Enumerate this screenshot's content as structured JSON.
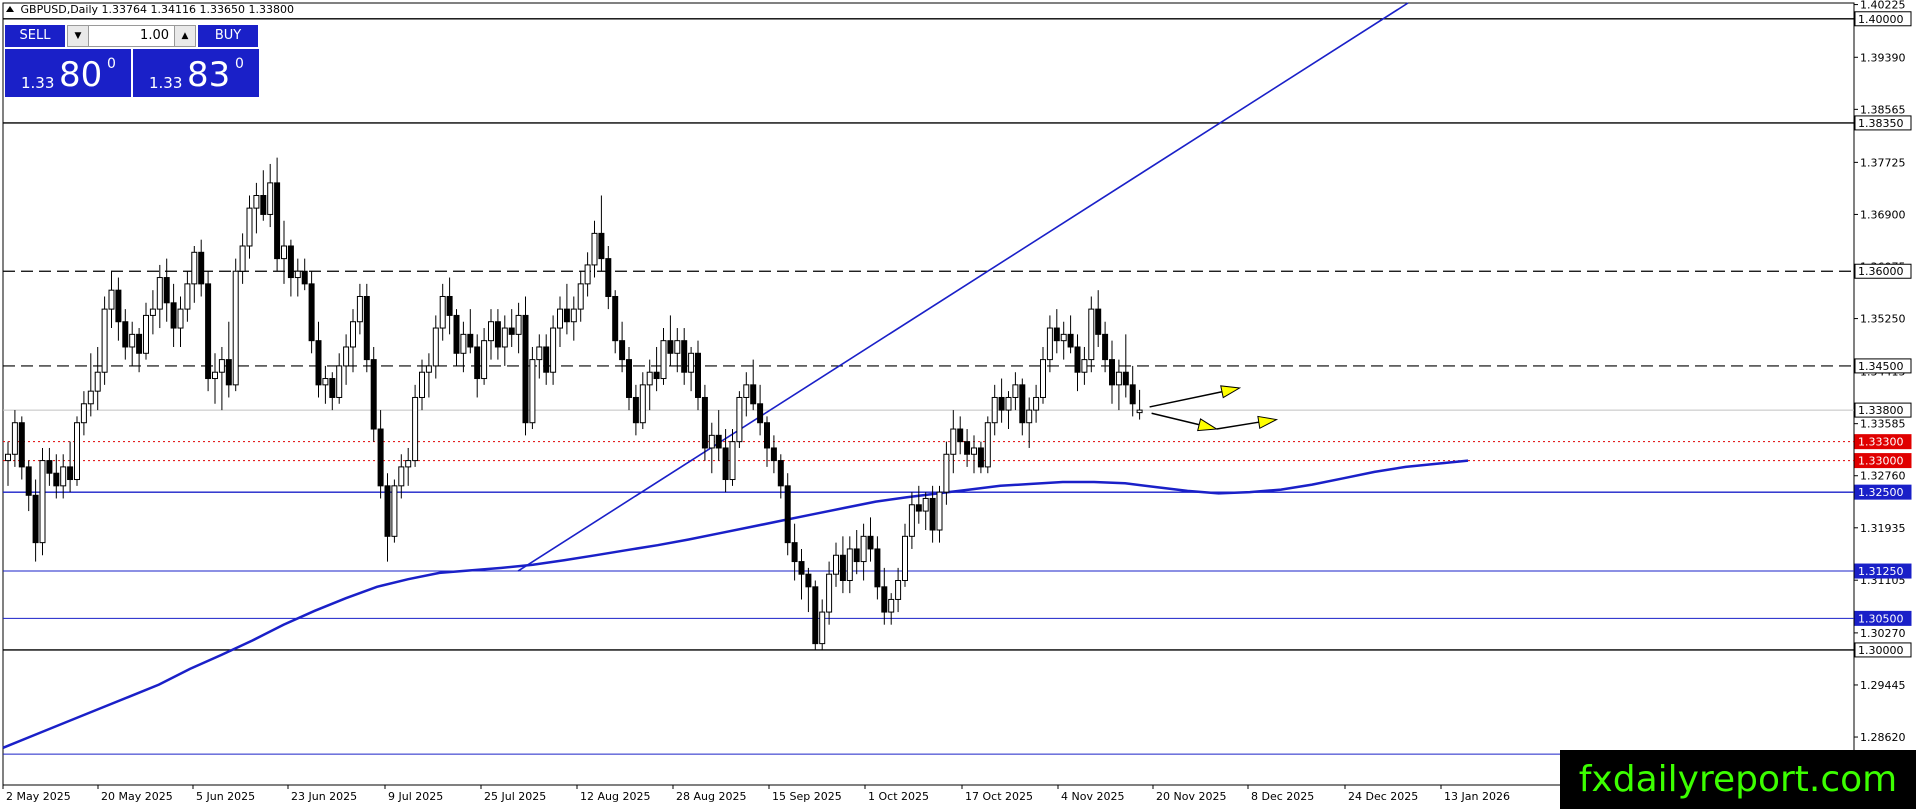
{
  "header": {
    "symbol": "GBPUSD,Daily",
    "ohlc": "1.33764 1.34116 1.33650 1.33800"
  },
  "trade_panel": {
    "sell_label": "SELL",
    "buy_label": "BUY",
    "quantity": "1.00",
    "sell_price_prefix": "1.33",
    "sell_price_big": "80",
    "sell_price_sup": "0",
    "buy_price_prefix": "1.33",
    "buy_price_big": "83",
    "buy_price_sup": "0"
  },
  "watermark": "fxdailyreport.com",
  "colors": {
    "blue": "#1a20c8",
    "level_red": "#e00000",
    "arrow_yellow": "#ffff00",
    "watermark_green": "#3cff00"
  },
  "chart_data": {
    "type": "candlestick",
    "symbol": "GBPUSD",
    "timeframe": "Daily",
    "last_price": 1.338,
    "ylim": [
      1.2786,
      1.4025
    ],
    "y_ticks": [
      "1.40225",
      "1.39390",
      "1.38565",
      "1.37725",
      "1.36900",
      "1.36075",
      "1.35250",
      "1.34415",
      "1.33585",
      "1.32760",
      "1.31935",
      "1.31105",
      "1.30270",
      "1.29445",
      "1.28620"
    ],
    "x_labels": [
      "2 May 2025",
      "20 May 2025",
      "5 Jun 2025",
      "23 Jun 2025",
      "9 Jul 2025",
      "25 Jul 2025",
      "12 Aug 2025",
      "28 Aug 2025",
      "15 Sep 2025",
      "1 Oct 2025",
      "17 Oct 2025",
      "4 Nov 2025",
      "20 Nov 2025",
      "8 Dec 2025",
      "24 Dec 2025",
      "13 Jan 2026"
    ],
    "horizontal_levels": [
      {
        "label": "1.40000",
        "value": 1.4,
        "style": "solid",
        "color": "#000000"
      },
      {
        "label": "1.38350",
        "value": 1.3835,
        "style": "solid",
        "color": "#000000"
      },
      {
        "label": "1.36000",
        "value": 1.36,
        "style": "dashed",
        "color": "#000000"
      },
      {
        "label": "1.34500",
        "value": 1.345,
        "style": "dashed",
        "color": "#000000"
      },
      {
        "label": "1.33800",
        "value": 1.338,
        "style": "price",
        "color": "#c0c0c0"
      },
      {
        "label": "1.33300",
        "value": 1.333,
        "style": "dotted",
        "color": "#e00000"
      },
      {
        "label": "1.33000",
        "value": 1.33,
        "style": "dotted",
        "color": "#e00000"
      },
      {
        "label": "1.32500",
        "value": 1.325,
        "style": "solid",
        "color": "#1a20c8"
      },
      {
        "label": "1.31250",
        "value": 1.3125,
        "style": "thin",
        "color": "#1a20c8"
      },
      {
        "label": "1.30500",
        "value": 1.305,
        "style": "thin",
        "color": "#1a20c8"
      },
      {
        "label": "1.30000",
        "value": 1.3,
        "style": "solid",
        "color": "#000000"
      },
      {
        "value": 1.2835,
        "style": "thin",
        "color": "#1a20c8"
      }
    ],
    "moving_average": [
      1.2845,
      1.2865,
      1.2885,
      1.2905,
      1.2925,
      1.2945,
      1.297,
      1.2992,
      1.3015,
      1.304,
      1.3062,
      1.3082,
      1.31,
      1.3112,
      1.3122,
      1.3126,
      1.313,
      1.3135,
      1.3142,
      1.315,
      1.3158,
      1.3166,
      1.3175,
      1.3185,
      1.3195,
      1.3205,
      1.3215,
      1.3225,
      1.3235,
      1.3242,
      1.3248,
      1.3254,
      1.326,
      1.3263,
      1.3266,
      1.3266,
      1.3264,
      1.3258,
      1.3252,
      1.3248,
      1.325,
      1.3254,
      1.3262,
      1.3272,
      1.3282,
      1.329,
      1.3295,
      1.33
    ],
    "trendline": {
      "from": "25 Jul 2025",
      "from_value": 1.3125,
      "to_value": 1.4025
    },
    "forecast_arrows": [
      {
        "description": "upper path",
        "points": [
          1.3385,
          1.3415
        ]
      },
      {
        "description": "lower path",
        "points": [
          1.3375,
          1.335,
          1.3365
        ]
      }
    ],
    "candles": [
      [
        1.33,
        1.333,
        1.326,
        1.331
      ],
      [
        1.331,
        1.338,
        1.329,
        1.336
      ],
      [
        1.336,
        1.337,
        1.327,
        1.329
      ],
      [
        1.329,
        1.33,
        1.322,
        1.3245
      ],
      [
        1.3245,
        1.327,
        1.314,
        1.317
      ],
      [
        1.317,
        1.332,
        1.315,
        1.33
      ],
      [
        1.33,
        1.332,
        1.326,
        1.328
      ],
      [
        1.328,
        1.331,
        1.324,
        1.326
      ],
      [
        1.326,
        1.331,
        1.324,
        1.329
      ],
      [
        1.329,
        1.333,
        1.325,
        1.327
      ],
      [
        1.327,
        1.337,
        1.326,
        1.336
      ],
      [
        1.336,
        1.341,
        1.334,
        1.339
      ],
      [
        1.339,
        1.347,
        1.337,
        1.341
      ],
      [
        1.341,
        1.348,
        1.338,
        1.344
      ],
      [
        1.344,
        1.356,
        1.342,
        1.354
      ],
      [
        1.354,
        1.36,
        1.351,
        1.357
      ],
      [
        1.357,
        1.359,
        1.349,
        1.352
      ],
      [
        1.352,
        1.354,
        1.346,
        1.348
      ],
      [
        1.348,
        1.352,
        1.345,
        1.35
      ],
      [
        1.35,
        1.351,
        1.344,
        1.347
      ],
      [
        1.347,
        1.355,
        1.346,
        1.353
      ],
      [
        1.353,
        1.357,
        1.35,
        1.354
      ],
      [
        1.354,
        1.361,
        1.351,
        1.359
      ],
      [
        1.359,
        1.362,
        1.352,
        1.355
      ],
      [
        1.355,
        1.358,
        1.348,
        1.351
      ],
      [
        1.351,
        1.356,
        1.348,
        1.354
      ],
      [
        1.354,
        1.36,
        1.352,
        1.358
      ],
      [
        1.358,
        1.364,
        1.355,
        1.363
      ],
      [
        1.363,
        1.365,
        1.356,
        1.358
      ],
      [
        1.358,
        1.36,
        1.341,
        1.343
      ],
      [
        1.343,
        1.347,
        1.339,
        1.344
      ],
      [
        1.344,
        1.348,
        1.338,
        1.346
      ],
      [
        1.346,
        1.352,
        1.34,
        1.342
      ],
      [
        1.342,
        1.362,
        1.341,
        1.36
      ],
      [
        1.36,
        1.366,
        1.358,
        1.364
      ],
      [
        1.364,
        1.372,
        1.362,
        1.37
      ],
      [
        1.37,
        1.374,
        1.366,
        1.372
      ],
      [
        1.372,
        1.376,
        1.368,
        1.369
      ],
      [
        1.369,
        1.377,
        1.367,
        1.374
      ],
      [
        1.374,
        1.378,
        1.36,
        1.362
      ],
      [
        1.362,
        1.368,
        1.358,
        1.364
      ],
      [
        1.364,
        1.365,
        1.356,
        1.359
      ],
      [
        1.359,
        1.362,
        1.356,
        1.36
      ],
      [
        1.36,
        1.362,
        1.357,
        1.358
      ],
      [
        1.358,
        1.36,
        1.347,
        1.349
      ],
      [
        1.349,
        1.352,
        1.34,
        1.342
      ],
      [
        1.342,
        1.345,
        1.339,
        1.343
      ],
      [
        1.343,
        1.344,
        1.338,
        1.34
      ],
      [
        1.34,
        1.347,
        1.339,
        1.345
      ],
      [
        1.345,
        1.35,
        1.342,
        1.348
      ],
      [
        1.348,
        1.354,
        1.344,
        1.352
      ],
      [
        1.352,
        1.358,
        1.35,
        1.356
      ],
      [
        1.356,
        1.358,
        1.344,
        1.346
      ],
      [
        1.346,
        1.348,
        1.333,
        1.335
      ],
      [
        1.335,
        1.338,
        1.324,
        1.326
      ],
      [
        1.326,
        1.328,
        1.314,
        1.318
      ],
      [
        1.318,
        1.327,
        1.317,
        1.326
      ],
      [
        1.326,
        1.331,
        1.324,
        1.329
      ],
      [
        1.329,
        1.332,
        1.326,
        1.33
      ],
      [
        1.33,
        1.342,
        1.329,
        1.34
      ],
      [
        1.34,
        1.346,
        1.338,
        1.344
      ],
      [
        1.344,
        1.347,
        1.34,
        1.345
      ],
      [
        1.345,
        1.353,
        1.343,
        1.351
      ],
      [
        1.351,
        1.358,
        1.349,
        1.356
      ],
      [
        1.356,
        1.359,
        1.35,
        1.353
      ],
      [
        1.353,
        1.354,
        1.345,
        1.347
      ],
      [
        1.347,
        1.352,
        1.344,
        1.35
      ],
      [
        1.35,
        1.354,
        1.347,
        1.348
      ],
      [
        1.348,
        1.35,
        1.34,
        1.343
      ],
      [
        1.343,
        1.351,
        1.342,
        1.349
      ],
      [
        1.349,
        1.354,
        1.346,
        1.352
      ],
      [
        1.352,
        1.354,
        1.346,
        1.348
      ],
      [
        1.348,
        1.353,
        1.345,
        1.351
      ],
      [
        1.351,
        1.354,
        1.348,
        1.35
      ],
      [
        1.35,
        1.355,
        1.347,
        1.353
      ],
      [
        1.353,
        1.356,
        1.334,
        1.336
      ],
      [
        1.336,
        1.348,
        1.335,
        1.346
      ],
      [
        1.346,
        1.35,
        1.343,
        1.348
      ],
      [
        1.348,
        1.35,
        1.342,
        1.344
      ],
      [
        1.344,
        1.353,
        1.342,
        1.351
      ],
      [
        1.351,
        1.356,
        1.348,
        1.354
      ],
      [
        1.354,
        1.358,
        1.35,
        1.352
      ],
      [
        1.352,
        1.356,
        1.349,
        1.354
      ],
      [
        1.354,
        1.36,
        1.352,
        1.358
      ],
      [
        1.358,
        1.363,
        1.356,
        1.361
      ],
      [
        1.361,
        1.368,
        1.359,
        1.366
      ],
      [
        1.366,
        1.372,
        1.36,
        1.362
      ],
      [
        1.362,
        1.364,
        1.354,
        1.356
      ],
      [
        1.356,
        1.357,
        1.347,
        1.349
      ],
      [
        1.349,
        1.352,
        1.344,
        1.346
      ],
      [
        1.346,
        1.348,
        1.338,
        1.34
      ],
      [
        1.34,
        1.342,
        1.334,
        1.336
      ],
      [
        1.336,
        1.344,
        1.335,
        1.342
      ],
      [
        1.342,
        1.346,
        1.338,
        1.344
      ],
      [
        1.344,
        1.348,
        1.341,
        1.343
      ],
      [
        1.343,
        1.351,
        1.342,
        1.349
      ],
      [
        1.349,
        1.353,
        1.345,
        1.347
      ],
      [
        1.347,
        1.351,
        1.344,
        1.349
      ],
      [
        1.349,
        1.351,
        1.342,
        1.344
      ],
      [
        1.344,
        1.348,
        1.341,
        1.347
      ],
      [
        1.347,
        1.349,
        1.338,
        1.34
      ],
      [
        1.34,
        1.342,
        1.33,
        1.332
      ],
      [
        1.332,
        1.336,
        1.328,
        1.334
      ],
      [
        1.334,
        1.338,
        1.33,
        1.332
      ],
      [
        1.332,
        1.335,
        1.325,
        1.327
      ],
      [
        1.327,
        1.335,
        1.326,
        1.333
      ],
      [
        1.333,
        1.341,
        1.332,
        1.34
      ],
      [
        1.34,
        1.344,
        1.337,
        1.342
      ],
      [
        1.342,
        1.346,
        1.338,
        1.339
      ],
      [
        1.339,
        1.342,
        1.334,
        1.336
      ],
      [
        1.336,
        1.337,
        1.329,
        1.332
      ],
      [
        1.332,
        1.334,
        1.328,
        1.33
      ],
      [
        1.33,
        1.331,
        1.324,
        1.326
      ],
      [
        1.326,
        1.328,
        1.315,
        1.317
      ],
      [
        1.317,
        1.32,
        1.311,
        1.314
      ],
      [
        1.314,
        1.316,
        1.308,
        1.312
      ],
      [
        1.312,
        1.313,
        1.306,
        1.31
      ],
      [
        1.31,
        1.311,
        1.3,
        1.301
      ],
      [
        1.301,
        1.308,
        1.3,
        1.306
      ],
      [
        1.306,
        1.314,
        1.304,
        1.312
      ],
      [
        1.312,
        1.317,
        1.31,
        1.315
      ],
      [
        1.315,
        1.318,
        1.309,
        1.311
      ],
      [
        1.311,
        1.318,
        1.309,
        1.316
      ],
      [
        1.316,
        1.319,
        1.312,
        1.314
      ],
      [
        1.314,
        1.32,
        1.311,
        1.318
      ],
      [
        1.318,
        1.321,
        1.314,
        1.316
      ],
      [
        1.316,
        1.318,
        1.308,
        1.31
      ],
      [
        1.31,
        1.313,
        1.304,
        1.306
      ],
      [
        1.306,
        1.309,
        1.304,
        1.308
      ],
      [
        1.308,
        1.313,
        1.306,
        1.311
      ],
      [
        1.311,
        1.32,
        1.31,
        1.318
      ],
      [
        1.318,
        1.325,
        1.316,
        1.323
      ],
      [
        1.323,
        1.326,
        1.32,
        1.322
      ],
      [
        1.322,
        1.325,
        1.319,
        1.324
      ],
      [
        1.324,
        1.326,
        1.317,
        1.319
      ],
      [
        1.319,
        1.326,
        1.317,
        1.325
      ],
      [
        1.325,
        1.333,
        1.323,
        1.331
      ],
      [
        1.331,
        1.338,
        1.328,
        1.335
      ],
      [
        1.335,
        1.337,
        1.331,
        1.333
      ],
      [
        1.333,
        1.335,
        1.329,
        1.331
      ],
      [
        1.331,
        1.334,
        1.328,
        1.332
      ],
      [
        1.332,
        1.333,
        1.328,
        1.329
      ],
      [
        1.329,
        1.337,
        1.328,
        1.336
      ],
      [
        1.336,
        1.342,
        1.334,
        1.34
      ],
      [
        1.34,
        1.343,
        1.336,
        1.338
      ],
      [
        1.338,
        1.341,
        1.335,
        1.34
      ],
      [
        1.34,
        1.344,
        1.338,
        1.342
      ],
      [
        1.342,
        1.343,
        1.334,
        1.336
      ],
      [
        1.336,
        1.34,
        1.332,
        1.338
      ],
      [
        1.338,
        1.342,
        1.336,
        1.34
      ],
      [
        1.34,
        1.348,
        1.339,
        1.346
      ],
      [
        1.346,
        1.353,
        1.344,
        1.351
      ],
      [
        1.351,
        1.354,
        1.347,
        1.349
      ],
      [
        1.349,
        1.352,
        1.346,
        1.35
      ],
      [
        1.35,
        1.353,
        1.347,
        1.348
      ],
      [
        1.348,
        1.35,
        1.341,
        1.344
      ],
      [
        1.344,
        1.348,
        1.342,
        1.346
      ],
      [
        1.346,
        1.356,
        1.344,
        1.354
      ],
      [
        1.354,
        1.357,
        1.348,
        1.35
      ],
      [
        1.35,
        1.352,
        1.344,
        1.346
      ],
      [
        1.346,
        1.349,
        1.339,
        1.342
      ],
      [
        1.342,
        1.346,
        1.338,
        1.344
      ],
      [
        1.344,
        1.35,
        1.34,
        1.342
      ],
      [
        1.342,
        1.345,
        1.337,
        1.339
      ],
      [
        1.3376,
        1.3412,
        1.3365,
        1.338
      ]
    ]
  }
}
